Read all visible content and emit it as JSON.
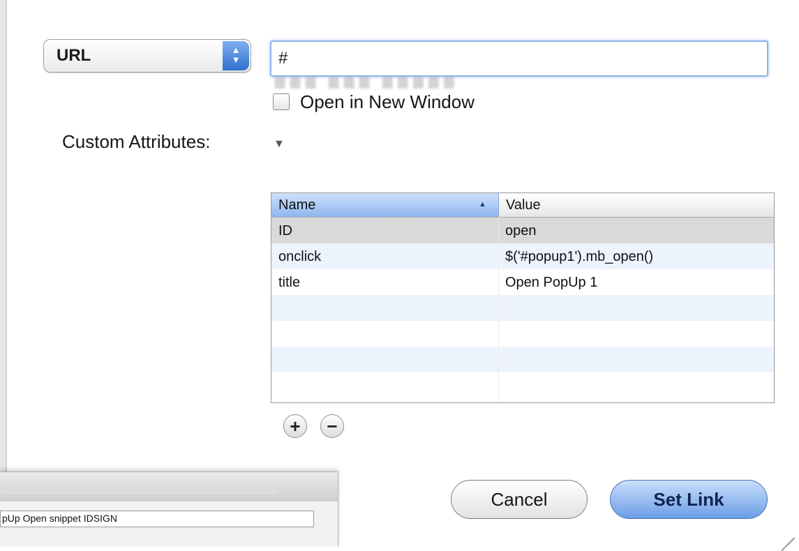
{
  "link_type": {
    "selected": "URL"
  },
  "url_field": {
    "value": "#"
  },
  "open_new_window": {
    "label": "Open in New Window",
    "checked": false
  },
  "custom_attributes": {
    "label": "Custom Attributes:",
    "table": {
      "columns": [
        "Name",
        "Value"
      ],
      "sort_column": "Name",
      "rows": [
        {
          "name": "ID",
          "value": "open"
        },
        {
          "name": "onclick",
          "value": "$('#popup1').mb_open()"
        },
        {
          "name": "title",
          "value": "Open PopUp 1"
        }
      ]
    },
    "add_symbol": "+",
    "remove_symbol": "−"
  },
  "buttons": {
    "cancel": "Cancel",
    "set_link": "Set Link"
  },
  "background_window": {
    "field_value": "pUp Open snippet IDSIGN"
  },
  "colors": {
    "accent": "#6c9ee6",
    "header_selected": "#8db6ef",
    "row_alt": "#edf3fd",
    "row_selected": "#d9d9d9"
  }
}
